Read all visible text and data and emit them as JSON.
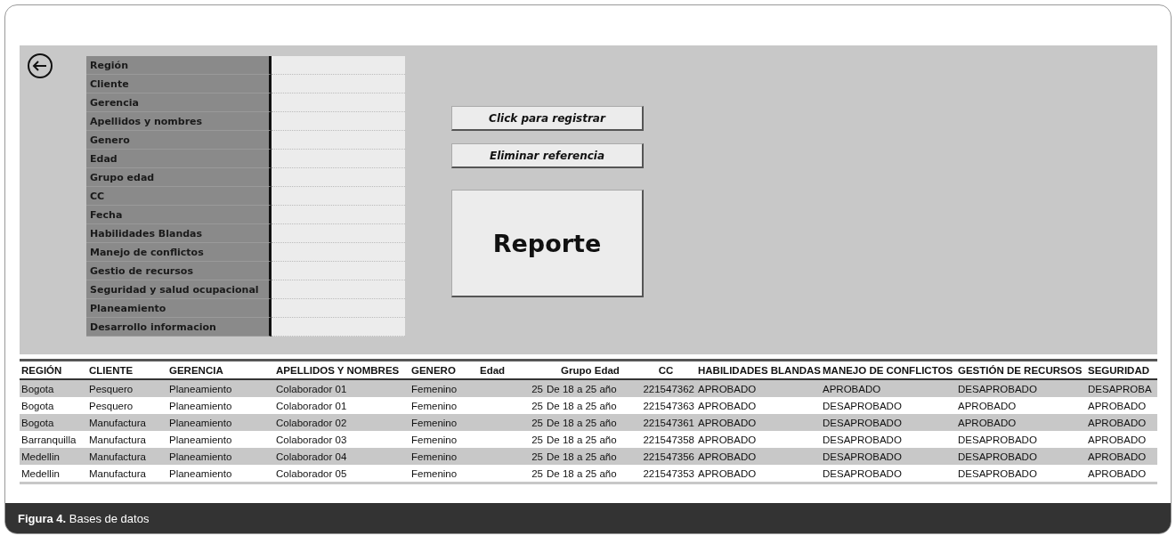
{
  "form": {
    "fields": [
      {
        "label": "Región"
      },
      {
        "label": "Cliente"
      },
      {
        "label": "Gerencia"
      },
      {
        "label": "Apellidos y nombres"
      },
      {
        "label": "Genero"
      },
      {
        "label": "Edad"
      },
      {
        "label": "Grupo edad"
      },
      {
        "label": "CC"
      },
      {
        "label": "Fecha"
      },
      {
        "label": "Habilidades Blandas"
      },
      {
        "label": "Manejo de conflictos"
      },
      {
        "label": "Gestio de recursos"
      },
      {
        "label": "Seguridad y salud ocupacional"
      },
      {
        "label": "Planeamiento"
      },
      {
        "label": "Desarrollo  informacion"
      }
    ],
    "buttons": [
      "Click para registrar",
      "Eliminar referencia"
    ],
    "report_button": "Reporte"
  },
  "table": {
    "columns": [
      "REGIÓN",
      "CLIENTE",
      "GERENCIA",
      "APELLIDOS Y NOMBRES",
      "GENERO",
      "Edad",
      "Grupo Edad",
      "CC",
      "HABILIDADES BLANDAS",
      "MANEJO DE CONFLICTOS",
      "GESTIÓN DE RECURSOS",
      "SEGURIDAD"
    ],
    "rows": [
      [
        "Bogota",
        "Pesquero",
        "Planeamiento",
        "Colaborador 01",
        "Femenino",
        "25",
        "De 18 a 25 año",
        "221547362",
        "APROBADO",
        "APROBADO",
        "DESAPROBADO",
        "DESAPROBA"
      ],
      [
        "Bogota",
        "Pesquero",
        "Planeamiento",
        "Colaborador 01",
        "Femenino",
        "25",
        "De 18 a 25 año",
        "221547363",
        "APROBADO",
        "DESAPROBADO",
        "APROBADO",
        "APROBADO"
      ],
      [
        "Bogota",
        "Manufactura",
        "Planeamiento",
        "Colaborador 02",
        "Femenino",
        "25",
        "De 18 a 25 año",
        "221547361",
        "APROBADO",
        "DESAPROBADO",
        "APROBADO",
        "APROBADO"
      ],
      [
        "Barranquilla",
        "Manufactura",
        "Planeamiento",
        "Colaborador 03",
        "Femenino",
        "25",
        "De 18 a 25 año",
        "221547358",
        "APROBADO",
        "DESAPROBADO",
        "DESAPROBADO",
        "APROBADO"
      ],
      [
        "Medellin",
        "Manufactura",
        "Planeamiento",
        "Colaborador 04",
        "Femenino",
        "25",
        "De 18 a 25 año",
        "221547356",
        "APROBADO",
        "DESAPROBADO",
        "DESAPROBADO",
        "APROBADO"
      ],
      [
        "Medellin",
        "Manufactura",
        "Planeamiento",
        "Colaborador 05",
        "Femenino",
        "25",
        "De 18 a 25 año",
        "221547353",
        "APROBADO",
        "DESAPROBADO",
        "DESAPROBADO",
        "APROBADO"
      ]
    ]
  },
  "caption": "**Figura 4.** Bases de datos"
}
